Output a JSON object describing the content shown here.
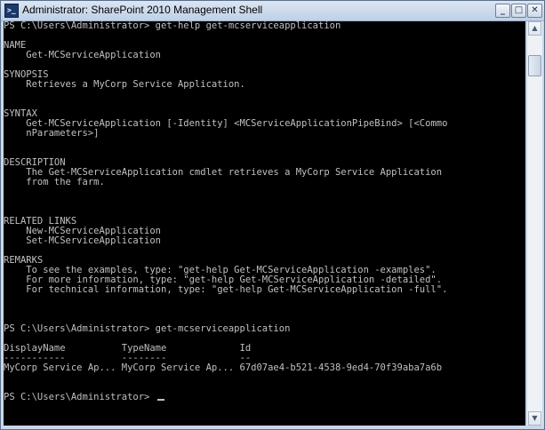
{
  "window": {
    "title": "Administrator: SharePoint 2010 Management Shell",
    "minimize_label": "_",
    "maximize_label": "□",
    "close_label": "✕",
    "icon_glyph": ">_"
  },
  "console": {
    "lines": [
      "PS C:\\Users\\Administrator> get-help get-mcserviceapplication",
      "",
      "NAME",
      "    Get-MCServiceApplication",
      "",
      "SYNOPSIS",
      "    Retrieves a MyCorp Service Application.",
      "",
      "",
      "SYNTAX",
      "    Get-MCServiceApplication [-Identity] <MCServiceApplicationPipeBind> [<Commo",
      "    nParameters>]",
      "",
      "",
      "DESCRIPTION",
      "    The Get-MCServiceApplication cmdlet retrieves a MyCorp Service Application",
      "    from the farm.",
      "",
      "",
      "",
      "RELATED LINKS",
      "    New-MCServiceApplication",
      "    Set-MCServiceApplication",
      "",
      "REMARKS",
      "    To see the examples, type: \"get-help Get-MCServiceApplication -examples\".",
      "    For more information, type: \"get-help Get-MCServiceApplication -detailed\".",
      "    For technical information, type: \"get-help Get-MCServiceApplication -full\".",
      "",
      "",
      "",
      "PS C:\\Users\\Administrator> get-mcserviceapplication",
      "",
      "DisplayName          TypeName             Id",
      "-----------          --------             --",
      "MyCorp Service Ap... MyCorp Service Ap... 67d07ae4-b521-4538-9ed4-70f39aba7a6b",
      "",
      "",
      "PS C:\\Users\\Administrator> "
    ]
  },
  "scrollbar": {
    "up_arrow": "▲",
    "down_arrow": "▼"
  }
}
